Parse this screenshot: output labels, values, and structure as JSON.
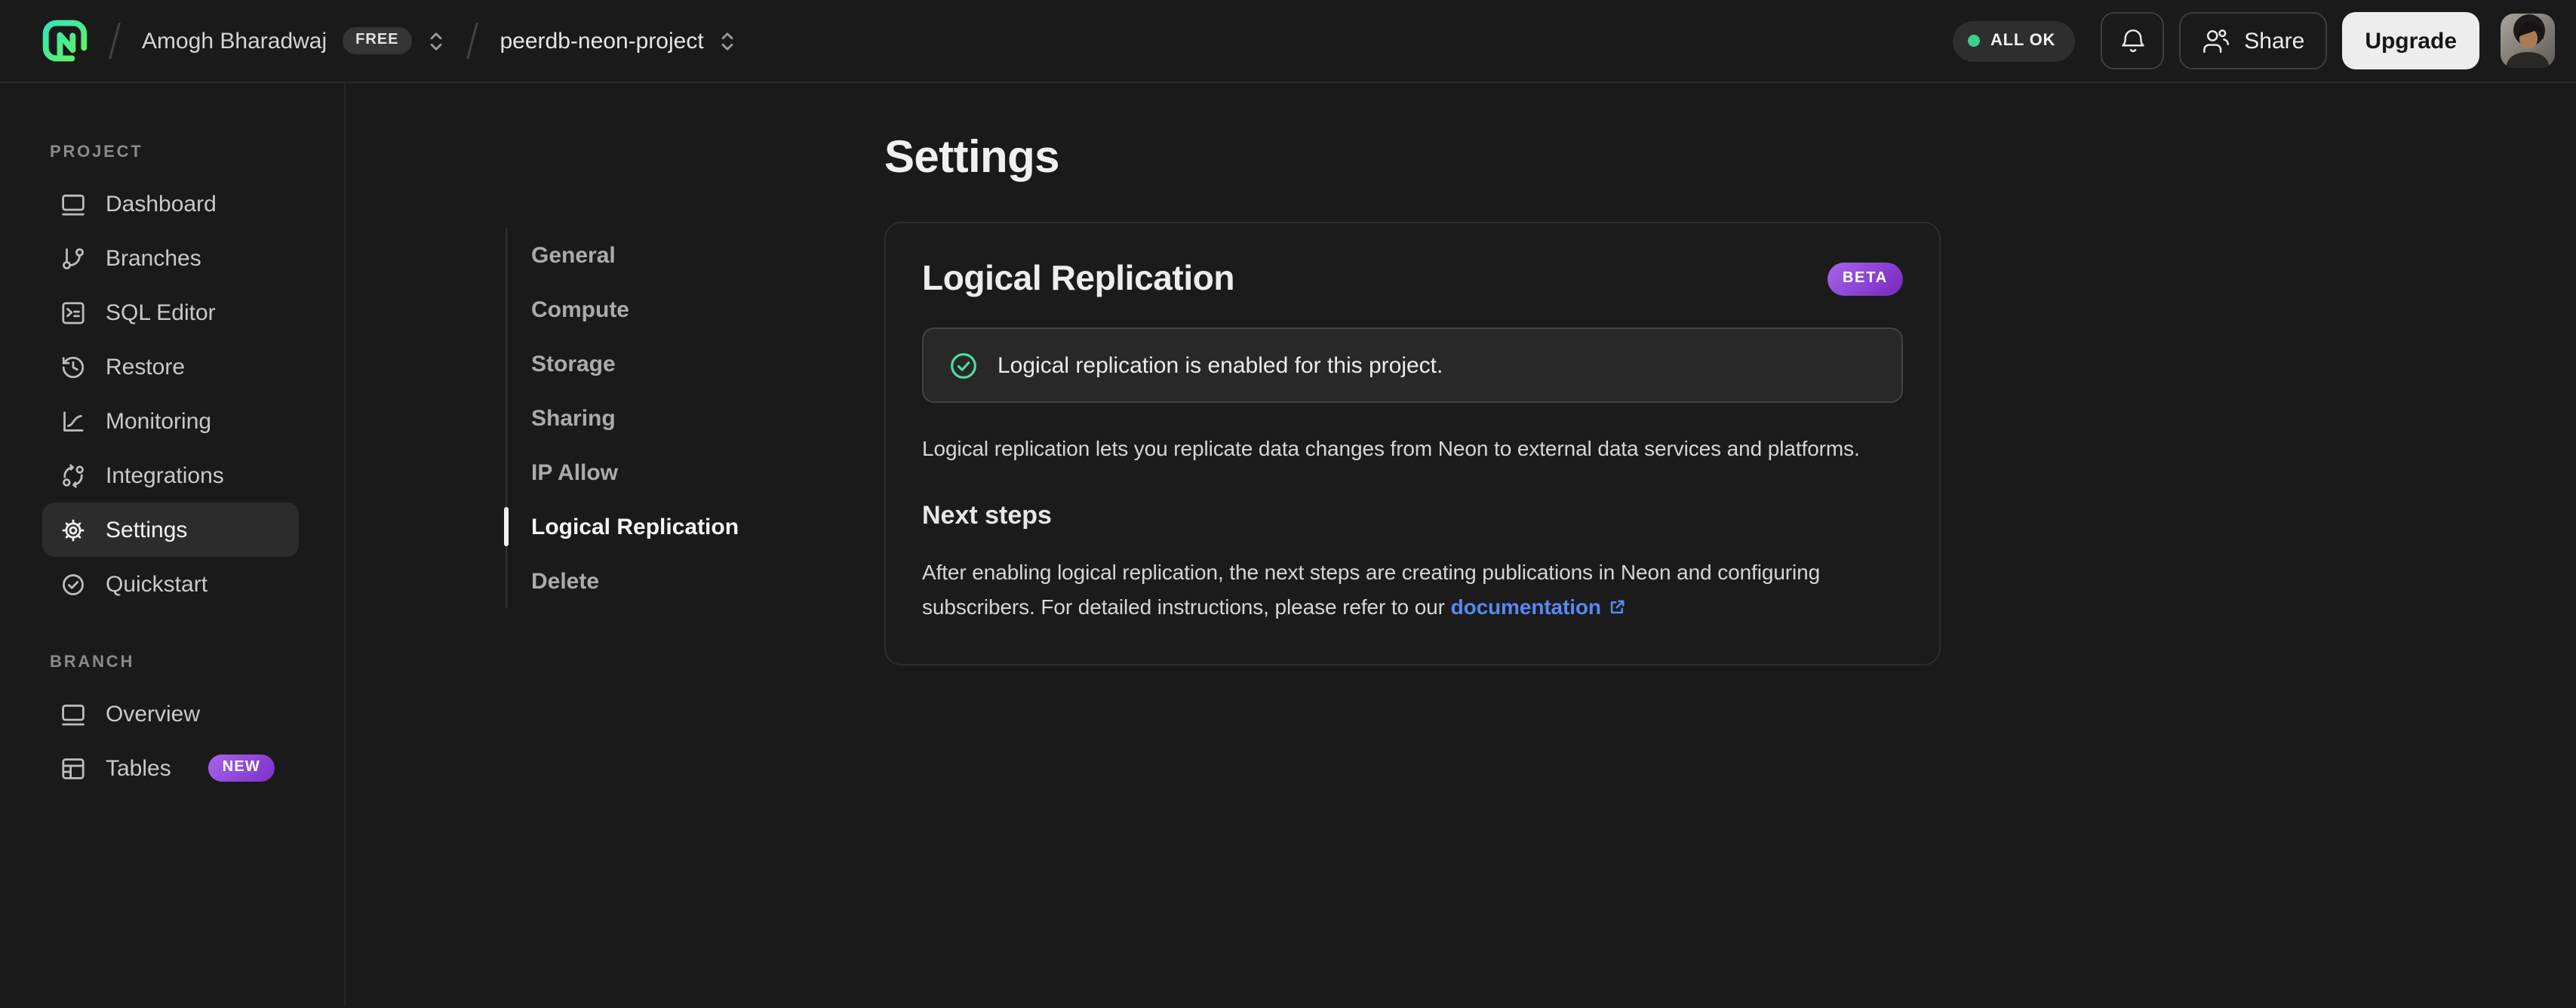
{
  "topbar": {
    "org_name": "Amogh Bharadwaj",
    "org_plan_badge": "FREE",
    "project_name": "peerdb-neon-project",
    "status_label": "ALL OK",
    "share_label": "Share",
    "upgrade_label": "Upgrade"
  },
  "sidebar": {
    "project_label": "PROJECT",
    "project_items": [
      {
        "label": "Dashboard",
        "icon": "window-icon"
      },
      {
        "label": "Branches",
        "icon": "git-branch-icon"
      },
      {
        "label": "SQL Editor",
        "icon": "terminal-icon"
      },
      {
        "label": "Restore",
        "icon": "history-icon"
      },
      {
        "label": "Monitoring",
        "icon": "chart-icon"
      },
      {
        "label": "Integrations",
        "icon": "integrations-icon"
      },
      {
        "label": "Settings",
        "icon": "gear-icon",
        "active": true
      },
      {
        "label": "Quickstart",
        "icon": "check-circle-icon"
      }
    ],
    "branch_label": "BRANCH",
    "branch_items": [
      {
        "label": "Overview",
        "icon": "window-icon"
      },
      {
        "label": "Tables",
        "icon": "table-icon",
        "badge": "NEW"
      }
    ]
  },
  "settings_nav": {
    "items": [
      {
        "label": "General"
      },
      {
        "label": "Compute"
      },
      {
        "label": "Storage"
      },
      {
        "label": "Sharing"
      },
      {
        "label": "IP Allow"
      },
      {
        "label": "Logical Replication",
        "active": true
      },
      {
        "label": "Delete"
      }
    ]
  },
  "main": {
    "page_title": "Settings",
    "card": {
      "heading": "Logical Replication",
      "beta_badge": "BETA",
      "alert_text": "Logical replication is enabled for this project.",
      "description": "Logical replication lets you replicate data changes from Neon to external data services and platforms.",
      "next_steps_heading": "Next steps",
      "next_steps_text": "After enabling logical replication, the next steps are creating publications in Neon and configuring subscribers. For detailed instructions, please refer to our ",
      "doc_link_label": "documentation"
    }
  },
  "colors": {
    "accent_green": "#3ecf8e",
    "badge_purple_light": "#a765ea",
    "badge_purple_dark": "#7527be",
    "link_blue": "#5689f2"
  }
}
